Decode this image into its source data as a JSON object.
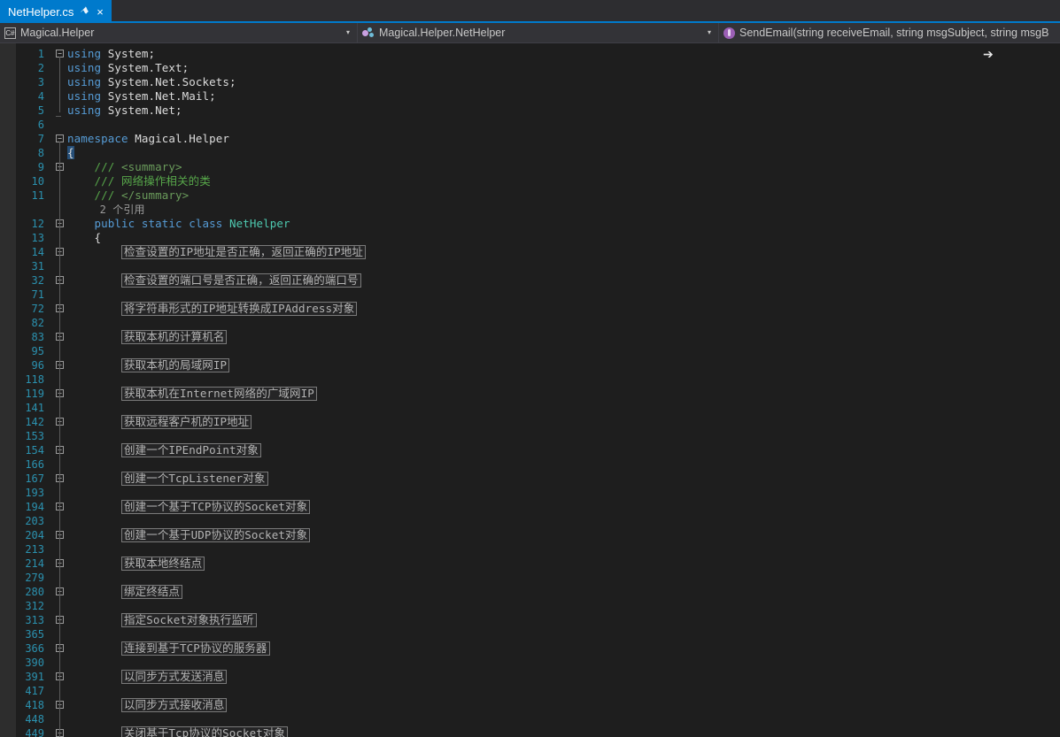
{
  "window": {
    "title": "NetHelper.cs"
  },
  "tabbar": {
    "tab_label": "NetHelper.cs",
    "pin_icon": "pin-icon",
    "close_icon": "close-icon",
    "pin_glyph": "⚑",
    "close_glyph": "×",
    "accent_color": "#007acc"
  },
  "navbar": {
    "project_dropdown": {
      "icon": "csharp-namespace-icon",
      "label": "Magical.Helper",
      "arrow": "▾"
    },
    "type_dropdown": {
      "icon": "class-icon",
      "label": "Magical.Helper.NetHelper",
      "arrow": "▾"
    },
    "member_dropdown": {
      "icon": "method-icon",
      "label": "SendEmail(string receiveEmail, string msgSubject, string msgB"
    }
  },
  "editor": {
    "theme": {
      "background": "#1e1e1e",
      "line_number_color": "#2b91af",
      "keyword_color": "#569cd6",
      "type_color": "#4ec9b0",
      "comment_color": "#57a64a",
      "text_color": "#dcdcdc",
      "collapsed_text_color": "#b4b4b4"
    },
    "lines": [
      {
        "n": "1",
        "fold": "minus",
        "segs": [
          {
            "t": "using ",
            "c": "kw"
          },
          {
            "t": "System;",
            "c": "id"
          }
        ]
      },
      {
        "n": "2",
        "fold": "",
        "segs": [
          {
            "t": "using ",
            "c": "kw"
          },
          {
            "t": "System.Text;",
            "c": "id"
          }
        ]
      },
      {
        "n": "3",
        "fold": "",
        "segs": [
          {
            "t": "using ",
            "c": "kw"
          },
          {
            "t": "System.Net.Sockets;",
            "c": "id"
          }
        ]
      },
      {
        "n": "4",
        "fold": "",
        "segs": [
          {
            "t": "using ",
            "c": "kw"
          },
          {
            "t": "System.Net.Mail;",
            "c": "id"
          }
        ]
      },
      {
        "n": "5",
        "fold": "",
        "segs": [
          {
            "t": "using ",
            "c": "kw"
          },
          {
            "t": "System.Net;",
            "c": "id"
          }
        ]
      },
      {
        "n": "6",
        "fold": "",
        "segs": []
      },
      {
        "n": "7",
        "fold": "minus",
        "segs": [
          {
            "t": "namespace ",
            "c": "kw"
          },
          {
            "t": "Magical.Helper",
            "c": "id"
          }
        ]
      },
      {
        "n": "8",
        "fold": "",
        "segs": [
          {
            "t": "{",
            "c": "caret"
          }
        ]
      },
      {
        "n": "9",
        "fold": "minus",
        "segs": [
          {
            "t": "    ",
            "c": "id"
          },
          {
            "t": "/// ",
            "c": "cmt"
          },
          {
            "t": "<summary>",
            "c": "cmtx"
          }
        ]
      },
      {
        "n": "10",
        "fold": "",
        "segs": [
          {
            "t": "    ",
            "c": "id"
          },
          {
            "t": "/// ",
            "c": "cmt"
          },
          {
            "t": "网络操作相关的类",
            "c": "cmt"
          }
        ]
      },
      {
        "n": "11",
        "fold": "",
        "segs": [
          {
            "t": "    ",
            "c": "id"
          },
          {
            "t": "/// ",
            "c": "cmt"
          },
          {
            "t": "</summary>",
            "c": "cmtx"
          }
        ]
      },
      {
        "n": "",
        "fold": "",
        "segs": [
          {
            "t": "     2 个引用",
            "c": "codelens"
          }
        ]
      },
      {
        "n": "12",
        "fold": "minus",
        "segs": [
          {
            "t": "    ",
            "c": "id"
          },
          {
            "t": "public static class ",
            "c": "kw"
          },
          {
            "t": "NetHelper",
            "c": "type"
          }
        ]
      },
      {
        "n": "13",
        "fold": "",
        "segs": [
          {
            "t": "    {",
            "c": "id"
          }
        ]
      },
      {
        "n": "14",
        "fold": "plus",
        "collapsed": "检查设置的IP地址是否正确，返回正确的IP地址"
      },
      {
        "n": "31",
        "fold": "",
        "segs": []
      },
      {
        "n": "32",
        "fold": "plus",
        "collapsed": "检查设置的端口号是否正确，返回正确的端口号"
      },
      {
        "n": "71",
        "fold": "",
        "segs": []
      },
      {
        "n": "72",
        "fold": "plus",
        "collapsed": "将字符串形式的IP地址转换成IPAddress对象"
      },
      {
        "n": "82",
        "fold": "",
        "segs": []
      },
      {
        "n": "83",
        "fold": "plus",
        "collapsed": "获取本机的计算机名"
      },
      {
        "n": "95",
        "fold": "",
        "segs": []
      },
      {
        "n": "96",
        "fold": "plus",
        "collapsed": "获取本机的局域网IP"
      },
      {
        "n": "118",
        "fold": "",
        "segs": []
      },
      {
        "n": "119",
        "fold": "plus",
        "collapsed": "获取本机在Internet网络的广域网IP"
      },
      {
        "n": "141",
        "fold": "",
        "segs": []
      },
      {
        "n": "142",
        "fold": "plus",
        "collapsed": "获取远程客户机的IP地址"
      },
      {
        "n": "153",
        "fold": "",
        "segs": []
      },
      {
        "n": "154",
        "fold": "plus",
        "collapsed": "创建一个IPEndPoint对象"
      },
      {
        "n": "166",
        "fold": "",
        "segs": []
      },
      {
        "n": "167",
        "fold": "plus",
        "collapsed": "创建一个TcpListener对象"
      },
      {
        "n": "193",
        "fold": "",
        "segs": []
      },
      {
        "n": "194",
        "fold": "plus",
        "collapsed": "创建一个基于TCP协议的Socket对象"
      },
      {
        "n": "203",
        "fold": "",
        "segs": []
      },
      {
        "n": "204",
        "fold": "plus",
        "collapsed": "创建一个基于UDP协议的Socket对象"
      },
      {
        "n": "213",
        "fold": "",
        "segs": []
      },
      {
        "n": "214",
        "fold": "plus",
        "collapsed": "获取本地终结点"
      },
      {
        "n": "279",
        "fold": "",
        "segs": []
      },
      {
        "n": "280",
        "fold": "plus",
        "collapsed": "绑定终结点"
      },
      {
        "n": "312",
        "fold": "",
        "segs": []
      },
      {
        "n": "313",
        "fold": "plus",
        "collapsed": "指定Socket对象执行监听"
      },
      {
        "n": "365",
        "fold": "",
        "segs": []
      },
      {
        "n": "366",
        "fold": "plus",
        "collapsed": "连接到基于TCP协议的服务器"
      },
      {
        "n": "390",
        "fold": "",
        "segs": []
      },
      {
        "n": "391",
        "fold": "plus",
        "collapsed": "以同步方式发送消息"
      },
      {
        "n": "417",
        "fold": "",
        "segs": []
      },
      {
        "n": "418",
        "fold": "plus",
        "collapsed": "以同步方式接收消息"
      },
      {
        "n": "448",
        "fold": "",
        "segs": []
      },
      {
        "n": "449",
        "fold": "plus",
        "collapsed": "关闭基于Tcp协议的Socket对象"
      }
    ]
  }
}
